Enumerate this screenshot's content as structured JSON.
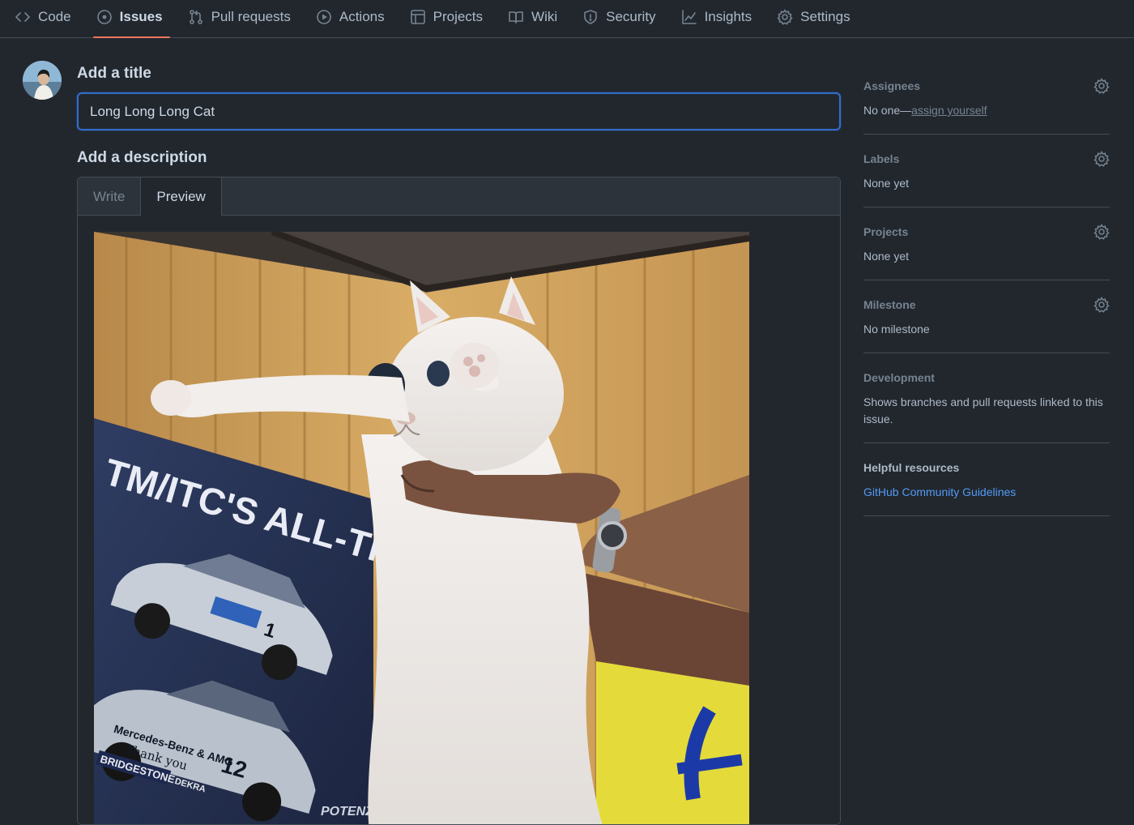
{
  "nav": {
    "tabs": [
      {
        "label": "Code",
        "icon": "code-icon"
      },
      {
        "label": "Issues",
        "icon": "issue-opened-icon",
        "active": true
      },
      {
        "label": "Pull requests",
        "icon": "git-pull-request-icon"
      },
      {
        "label": "Actions",
        "icon": "play-icon"
      },
      {
        "label": "Projects",
        "icon": "table-icon"
      },
      {
        "label": "Wiki",
        "icon": "book-icon"
      },
      {
        "label": "Security",
        "icon": "shield-icon"
      },
      {
        "label": "Insights",
        "icon": "graph-icon"
      },
      {
        "label": "Settings",
        "icon": "gear-icon"
      }
    ]
  },
  "form": {
    "title_label": "Add a title",
    "title_value": "Long Long Long Cat",
    "description_label": "Add a description",
    "tabs": {
      "write": "Write",
      "preview": "Preview"
    }
  },
  "sidebar": {
    "assignees": {
      "title": "Assignees",
      "value_prefix": "No one—",
      "value_link": "assign yourself"
    },
    "labels": {
      "title": "Labels",
      "value": "None yet"
    },
    "projects": {
      "title": "Projects",
      "value": "None yet"
    },
    "milestone": {
      "title": "Milestone",
      "value": "No milestone"
    },
    "development": {
      "title": "Development",
      "value": "Shows branches and pull requests linked to this issue."
    },
    "helpful": {
      "title": "Helpful resources",
      "link": "GitHub Community Guidelines"
    }
  },
  "preview_image": {
    "poster_headline": "TM/ITC'S ALL-TIME TOP TEAM.",
    "poster_text_1": "Thank you",
    "poster_brand": "BRIDGESTONE",
    "poster_brand_2": "Mercedes-Benz & AMG",
    "poster_number": "12",
    "poster_dekra": "DEKRA",
    "poster_footer": "POTENZ"
  },
  "colors": {
    "background": "#22272e",
    "border": "#444c56",
    "accent_focus": "#316dca",
    "active_tab_underline": "#ec775c",
    "link": "#539bf5"
  }
}
